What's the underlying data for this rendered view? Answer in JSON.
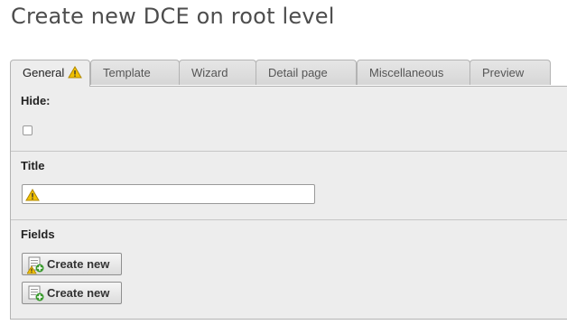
{
  "page": {
    "title": "Create new DCE on root level"
  },
  "tabs": [
    {
      "label": "General",
      "active": true,
      "warning": true
    },
    {
      "label": "Template"
    },
    {
      "label": "Wizard"
    },
    {
      "label": "Detail page"
    },
    {
      "label": "Miscellaneous"
    },
    {
      "label": "Preview"
    }
  ],
  "form": {
    "hide": {
      "label": "Hide:",
      "checked": false
    },
    "title": {
      "label": "Title",
      "value": "",
      "warning": true
    },
    "fields": {
      "label": "Fields",
      "buttons": [
        {
          "label": "Create new",
          "warning": true
        },
        {
          "label": "Create new",
          "warning": false
        }
      ]
    }
  },
  "colors": {
    "warning": "#f0c000",
    "add": "#3a9a2e"
  },
  "icons": {
    "warning": "warning-icon",
    "new_record": "new-record-icon"
  }
}
